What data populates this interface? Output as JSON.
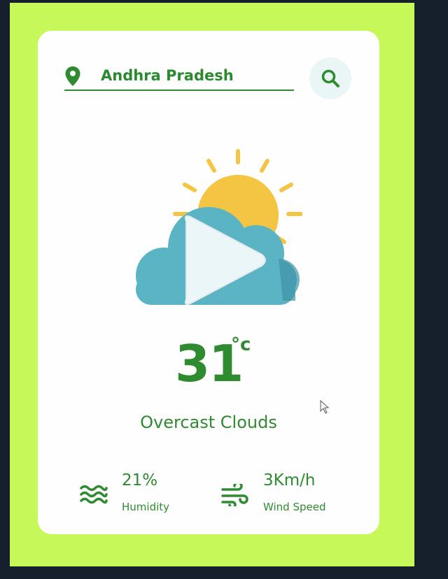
{
  "search": {
    "location_value": "Andhra Pradesh",
    "pin_icon": "map-pin-icon",
    "search_icon": "search-icon"
  },
  "weather": {
    "icon": "sun-behind-cloud-icon",
    "temperature": "31",
    "unit": "°c",
    "condition": "Overcast Clouds"
  },
  "stats": {
    "humidity": {
      "icon": "waves-icon",
      "value": "21%",
      "label": "Humidity"
    },
    "wind": {
      "icon": "wind-icon",
      "value": "3Km/h",
      "label": "Wind Speed"
    }
  },
  "overlay": {
    "icon": "play-icon"
  },
  "colors": {
    "frame": "#c6f85a",
    "accent": "#2e8b30",
    "sun": "#f4c542",
    "cloud": "#5ab4c4",
    "page_bg": "#16202c"
  }
}
